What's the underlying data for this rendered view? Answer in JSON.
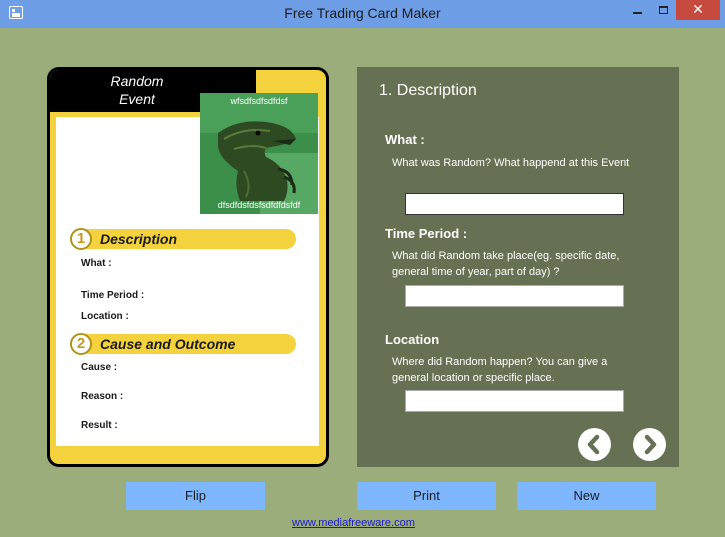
{
  "window": {
    "title": "Free Trading Card Maker",
    "close_glyph": "✕"
  },
  "card": {
    "category_line1": "Random",
    "category_line2": "Event",
    "photo_caption_top": "wfsdfsdfsdfdsf",
    "photo_caption_bottom": "dfsdfdsfdsfsdfdfdsfdf",
    "section1": {
      "number": "1",
      "title": "Description"
    },
    "section2": {
      "number": "2",
      "title": "Cause and Outcome"
    },
    "fields": {
      "what": "What :",
      "time_period": "Time Period :",
      "location": "Location :",
      "cause": "Cause :",
      "reason": "Reason :",
      "result": "Result :"
    }
  },
  "panel": {
    "title": "1. Description",
    "what_label": "What :",
    "what_help": "What was Random? What happend at this Event",
    "what_value": "",
    "time_label": "Time Period :",
    "time_help": "What did Random take place(eg. specific date, general time of year, part of day) ?",
    "time_value": "",
    "location_label": "Location",
    "location_help": "Where did Random happen? You can give a general location or specific place.",
    "location_value": ""
  },
  "buttons": {
    "flip": "Flip",
    "print": "Print",
    "new": "New"
  },
  "footer_link": "www.mediafreeware.com",
  "colors": {
    "background": "#9bad7b",
    "card_yellow": "#f3d23e",
    "panel": "#667153",
    "button_blue": "#7fb7ff",
    "titlebar": "#6e9ee6"
  }
}
